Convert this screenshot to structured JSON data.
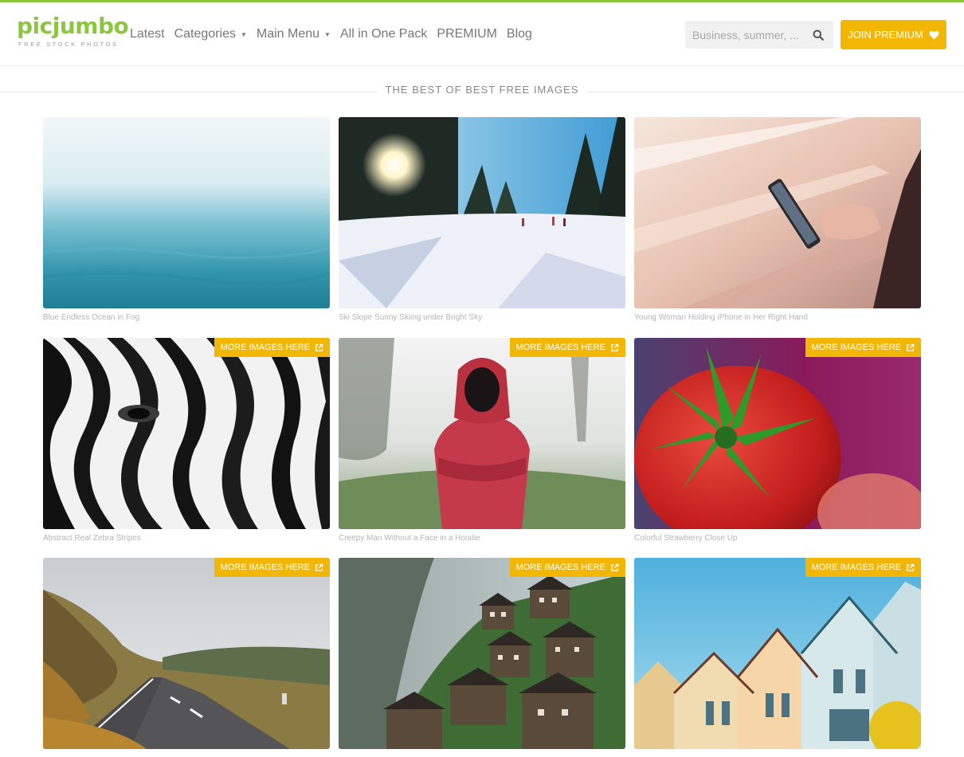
{
  "brand": {
    "name": "picjumbo",
    "tagline": "FREE STOCK PHOTOS",
    "accent": "#8cc63f",
    "highlight": "#f2b705"
  },
  "nav": {
    "items": [
      {
        "label": "Latest",
        "has_caret": false
      },
      {
        "label": "Categories",
        "has_caret": true
      },
      {
        "label": "Main Menu",
        "has_caret": true
      },
      {
        "label": "All in One Pack",
        "has_caret": false
      },
      {
        "label": "PREMIUM",
        "has_caret": false
      },
      {
        "label": "Blog",
        "has_caret": false
      }
    ]
  },
  "search": {
    "placeholder": "Business, summer, ...",
    "value": "",
    "icon": "search-icon"
  },
  "join_button": {
    "label": "JOIN PREMIUM",
    "icon": "heart-icon"
  },
  "section": {
    "heading": "THE BEST OF BEST FREE IMAGES"
  },
  "more_images_label": "MORE IMAGES HERE",
  "cards": [
    {
      "caption": "Blue Endless Ocean in Fog",
      "more": false
    },
    {
      "caption": "Ski Slope Sunny Skiing under Bright Sky",
      "more": false
    },
    {
      "caption": "Young Woman Holding iPhone in Her Right Hand",
      "more": false
    },
    {
      "caption": "Abstract Real Zebra Stripes",
      "more": true
    },
    {
      "caption": "Creepy Man Without a Face in a Hoodie",
      "more": true
    },
    {
      "caption": "Colorful Strawberry Close Up",
      "more": true
    },
    {
      "caption": "",
      "more": true
    },
    {
      "caption": "",
      "more": true
    },
    {
      "caption": "",
      "more": true
    }
  ]
}
